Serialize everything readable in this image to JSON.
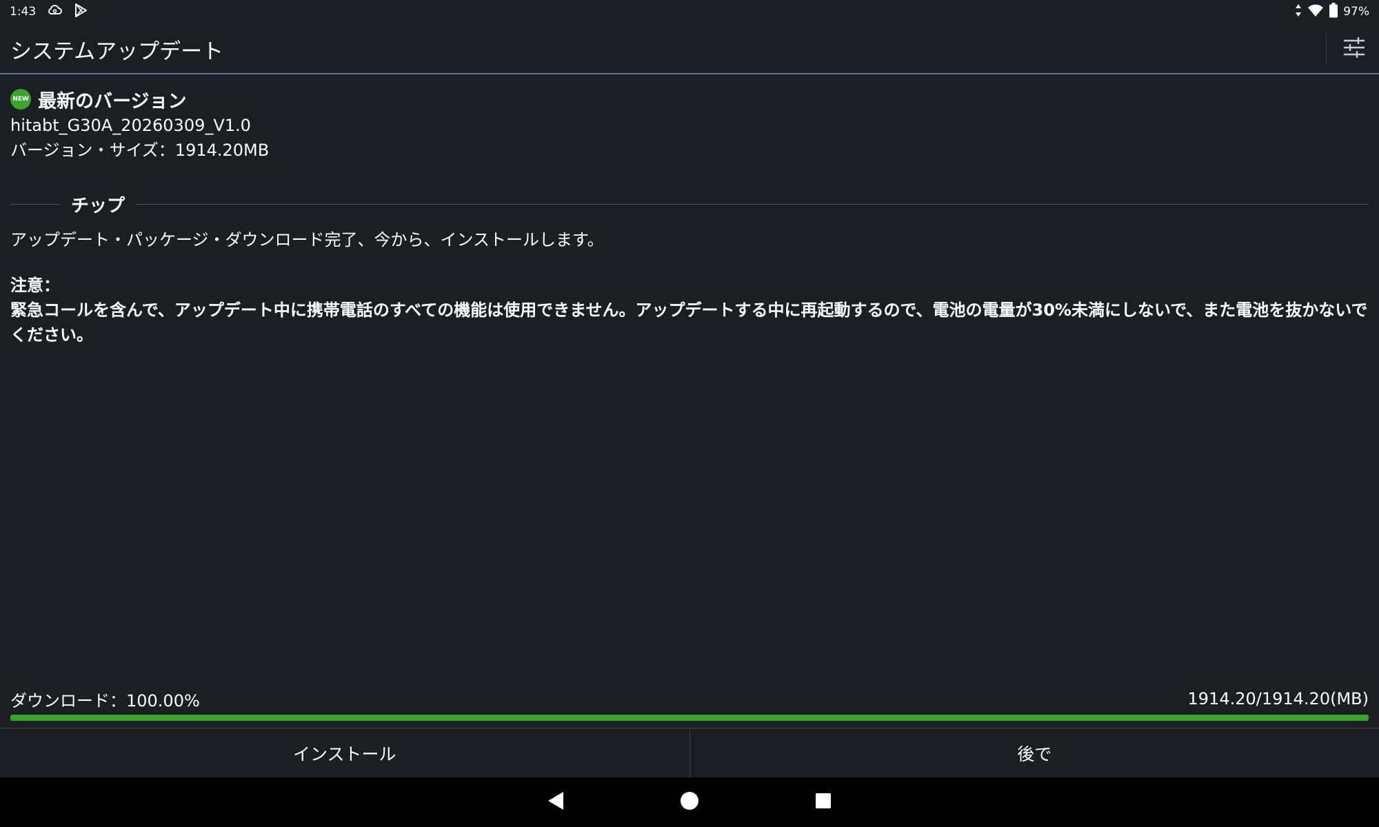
{
  "status_bar": {
    "time": "1:43",
    "icons_left": [
      "cloud-sync-icon",
      "play-store-icon"
    ],
    "icons_right": [
      "data-arrows-icon",
      "wifi-icon",
      "battery-icon"
    ],
    "battery": "97%"
  },
  "app_bar": {
    "title": "システムアップデート",
    "settings_icon": "tune-sliders-icon"
  },
  "version": {
    "badge": "NEW",
    "heading": "最新のバージョン",
    "name": "hitabt_G30A_20260309_V1.0",
    "size": "バージョン・サイズ：1914.20MB"
  },
  "tips": {
    "label": "チップ",
    "message": "アップデート・パッケージ・ダウンロード完了、今から、インストールします。",
    "note_title": "注意：",
    "note_text": "緊急コールを含んで、アップデート中に携帯電話のすべての機能は使用できません。アップデートする中に再起動するので、電池の電量が30%未満にしないで、また電池を抜かないでください。"
  },
  "download": {
    "label": "ダウンロード：100.00%",
    "amount": "1914.20/1914.20(MB)",
    "progress": 1.0
  },
  "buttons": {
    "install": "インストール",
    "later": "後で"
  },
  "colors": {
    "background": "#1b1e23",
    "accent_green": "#3aa42c",
    "app_bar_underline": "#5d7a96"
  }
}
